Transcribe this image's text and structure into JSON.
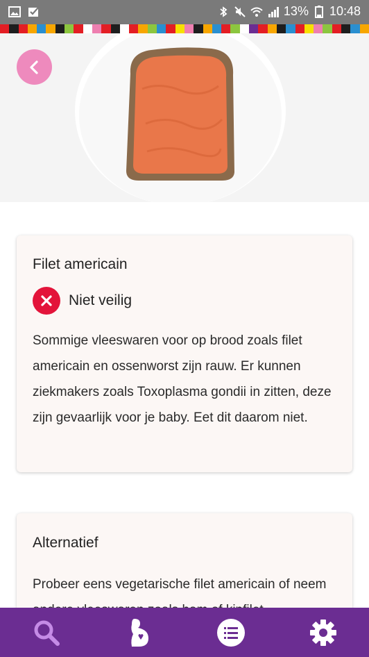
{
  "status_bar": {
    "battery_percent": "13%",
    "time": "10:48",
    "left_icons": [
      "image-icon",
      "check-mail-icon"
    ],
    "right_icons": [
      "bluetooth-icon",
      "mute-icon",
      "wifi-icon",
      "signal-icon",
      "battery-icon"
    ]
  },
  "stripe_colors": [
    "#e31e24",
    "#1e1e1e",
    "#e31e24",
    "#f7a600",
    "#2a8fd0",
    "#f7a600",
    "#1e1e1e",
    "#8cc63f",
    "#e31e24",
    "#ffffff",
    "#ee7fb0",
    "#e31e24",
    "#1e1e1e",
    "#ffffff",
    "#e31e24",
    "#f7a600",
    "#8cc63f",
    "#2a8fd0",
    "#e31e24",
    "#f7e000",
    "#ee7fb0",
    "#1e1e1e",
    "#f7a600",
    "#2a8fd0",
    "#e31e24",
    "#8cc63f",
    "#ffffff",
    "#6b2d92",
    "#e31e24",
    "#f7a600",
    "#1e1e1e",
    "#2a8fd0",
    "#e31e24",
    "#f7e000",
    "#ee7fb0",
    "#8cc63f",
    "#e31e24",
    "#1e1e1e",
    "#2a8fd0",
    "#f7a600"
  ],
  "hero": {
    "icon": "back-arrow-icon"
  },
  "food_card": {
    "title": "Filet americain",
    "verdict_label": "Niet veilig",
    "verdict_icon": "x-circle-icon",
    "description": "Sommige vleeswaren voor op brood zoals filet americain en ossenworst zijn rauw. Er kunnen ziekmakers zoals Toxoplasma gondii in zitten, deze zijn gevaarlijk voor je baby. Eet dit daarom niet."
  },
  "alternative_card": {
    "title": "Alternatief",
    "text": "Probeer eens vegetarische filet americain of neem andere vleeswaren zoals ham of kipfilet."
  },
  "bottom_nav": {
    "items": [
      "search-icon",
      "pregnancy-icon",
      "list-icon",
      "settings-icon"
    ],
    "active_color": "#c58be6",
    "icon_color": "#ffffff"
  },
  "colors": {
    "accent_pink": "#ee8abd",
    "danger_red": "#e3143a",
    "nav_purple": "#6b2d92"
  }
}
